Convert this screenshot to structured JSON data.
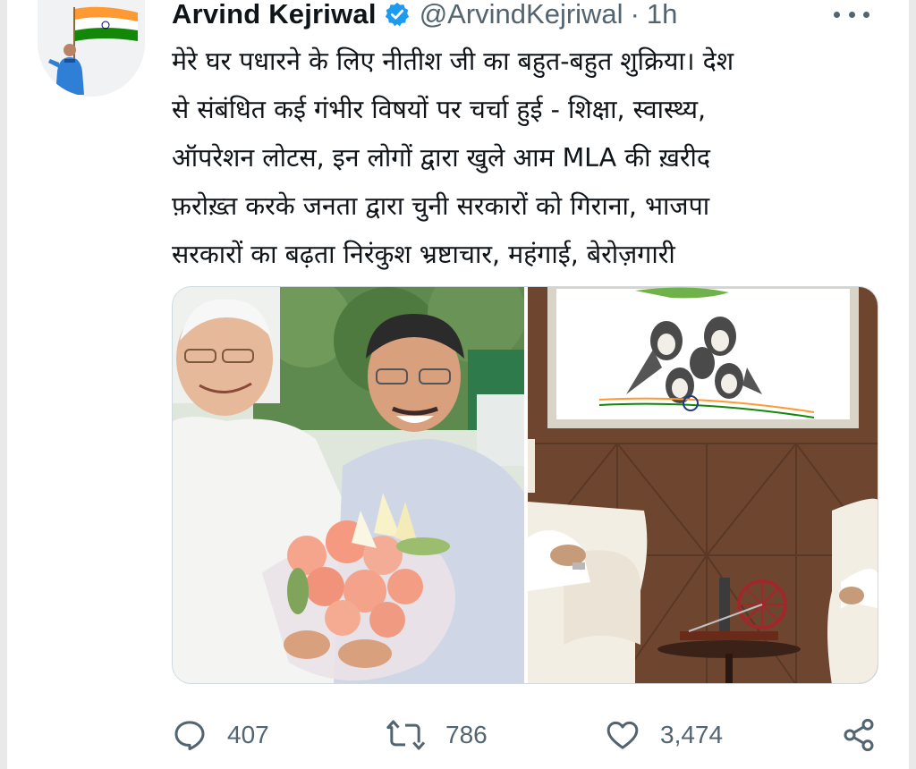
{
  "tweet": {
    "author_name": "Arvind Kejriwal",
    "verified": true,
    "handle": "@ArvindKejriwal",
    "separator": "·",
    "time": "1h",
    "text_lines": [
      "मेरे घर पधारने के लिए नीतीश जी का बहुत-बहुत शुक्रिया। देश",
      "से संबंधित कई गंभीर विषयों पर चर्चा हुई - शिक्षा, स्वास्थ्य,",
      "ऑपरेशन लोटस, इन लोगों द्वारा खुले आम MLA की ख़रीद",
      "फ़रोख़्त करके जनता द्वारा चुनी सरकारों को गिराना, भाजपा",
      "सरकारों का बढ़ता निरंकुश भ्रष्टाचार, महंगाई, बेरोज़गारी"
    ]
  },
  "media": {
    "photos": [
      {
        "icon": "photo-bouquet-meeting"
      },
      {
        "icon": "photo-meeting-room"
      }
    ]
  },
  "actions": {
    "reply": {
      "icon": "reply-icon",
      "count": "407"
    },
    "retweet": {
      "icon": "retweet-icon",
      "count": "786"
    },
    "like": {
      "icon": "heart-icon",
      "count": "3,474"
    },
    "share": {
      "icon": "share-icon"
    }
  },
  "colors": {
    "text": "#0f1419",
    "secondary": "#536471",
    "verified": "#1d9bf0",
    "border": "#cfd9de"
  }
}
